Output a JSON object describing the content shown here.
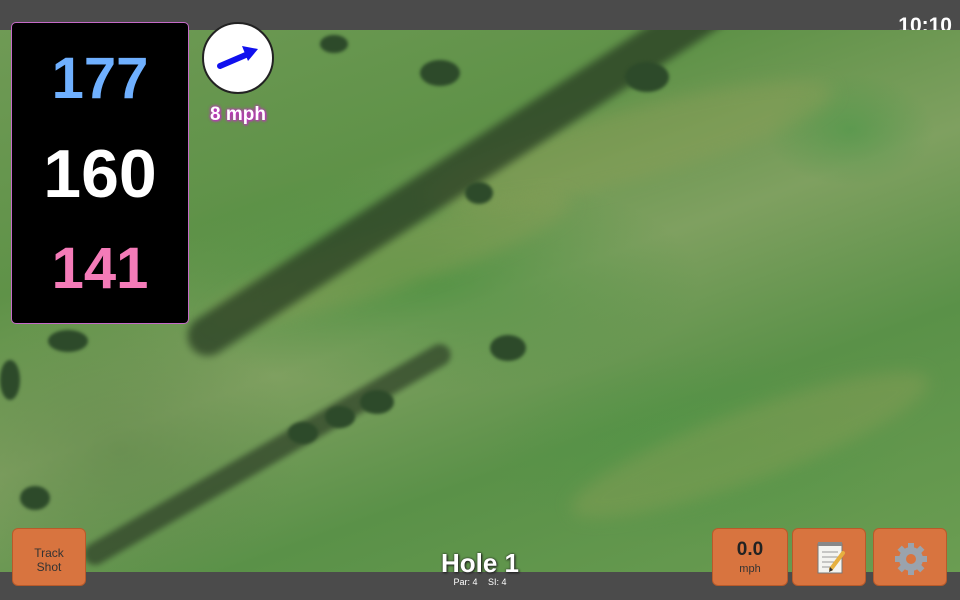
{
  "status": {
    "time": "10:10"
  },
  "distances": {
    "back": "177",
    "middle": "160",
    "front": "141",
    "colors": {
      "back": "#6fb0ff",
      "middle": "#ffffff",
      "front": "#f47bb8"
    }
  },
  "wind": {
    "speed": "8 mph",
    "icon": "wind-direction-arrow-icon",
    "direction": "north-east"
  },
  "buttons": {
    "track_shot_line1": "Track",
    "track_shot_line2": "Shot",
    "speed_value": "0.0",
    "speed_unit": "mph",
    "notes_icon": "notepad-icon",
    "settings_icon": "gear-icon"
  },
  "hole": {
    "title": "Hole 1",
    "par": "Par: 4",
    "si": "SI: 4"
  },
  "accent": "#d8743f"
}
